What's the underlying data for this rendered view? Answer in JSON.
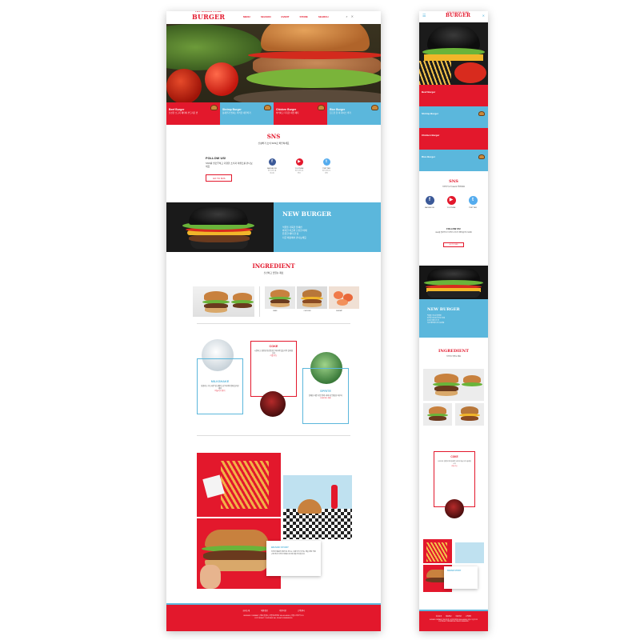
{
  "brand": {
    "logo": "BURGER",
    "logo_arc": "THE BURGER STORE",
    "accent_red": "#e3182c",
    "accent_blue": "#5bb7dc"
  },
  "nav": {
    "items": [
      "MENU",
      "SEASON",
      "EVENT",
      "STORE",
      "SEARCH"
    ]
  },
  "feature_cards": [
    {
      "title": "Beef Burger",
      "desc": "신선한 소고기 패티와 부드러운 번"
    },
    {
      "title": "Shrimp Burger",
      "desc": "통새우가 씹히는 바삭한 새우버거"
    },
    {
      "title": "Chicken Burger",
      "desc": "바삭하고 촉촉한 치킨 패티"
    },
    {
      "title": "Rice Burger",
      "desc": "든든한 한 끼 라이스 버거"
    }
  ],
  "sns": {
    "title": "SNS",
    "subtitle": "신상버거 소식 SNS로 확인하세요",
    "follow_title": "FOLLOW US!",
    "follow_text": "SNS를 팔로우하고 다양한 소식과 이벤트를 만나보세요",
    "button": "GO TO SNS",
    "channels": [
      {
        "icon": "f",
        "name": "FACEBOOK",
        "meta": "버거 공식 페이스북"
      },
      {
        "icon": "▶",
        "name": "YOUTUBE",
        "meta": "버거 공식 유튜브"
      },
      {
        "icon": "t",
        "name": "TWITTER",
        "meta": "버거 공식 트위터"
      }
    ]
  },
  "new_burger": {
    "title": "NEW BURGER",
    "lines": [
      "먹물을 가득한 블랙번",
      "바삭한 치즈와 신선한 야채",
      "든든한 패티 한 장",
      "지금 매장에서 만나보세요"
    ]
  },
  "ingredient": {
    "title": "INGREDIENT",
    "subtitle": "신선하고 맛있는 재료",
    "captions": [
      "BEEF",
      "CHICKEN",
      "SHRIMP"
    ]
  },
  "drinks": {
    "milkshake": {
      "title": "MILKSHAKE",
      "text": "달콤하고 부드러운 밀크쉐이크로 버거와 함께 즐겨보세요",
      "highlight": "바닐라 & 딸기"
    },
    "coke": {
      "title": "COKE",
      "text": "시원하고 청량한 탄산음료로 버거의 맛을 더욱 살려줍니다",
      "highlight": "리필 가능"
    },
    "sprite": {
      "title": "SPRITE",
      "text": "상쾌한 레몬 라임 향의 사이다로 깔끔한 마무리",
      "highlight": "LEMON LIME"
    }
  },
  "brand_story": {
    "title": "BRAND STORY",
    "text": "신선한 재료와 정성으로 만드는 수제 버거. 버거는 매일 아침 직접 구운 번과 신선한 야채로 최고의 맛을 선사합니다."
  },
  "footer": {
    "links": [
      "회사소개",
      "채용정보",
      "이용약관",
      "고객센터"
    ],
    "text": "BURGER COMPANY | 대표 홍길동 | 사업자등록번호 000-00-00000 | 서울시 어딘가 123",
    "copyright": "COPYRIGHT © BURGER. ALL RIGHTS RESERVED."
  }
}
